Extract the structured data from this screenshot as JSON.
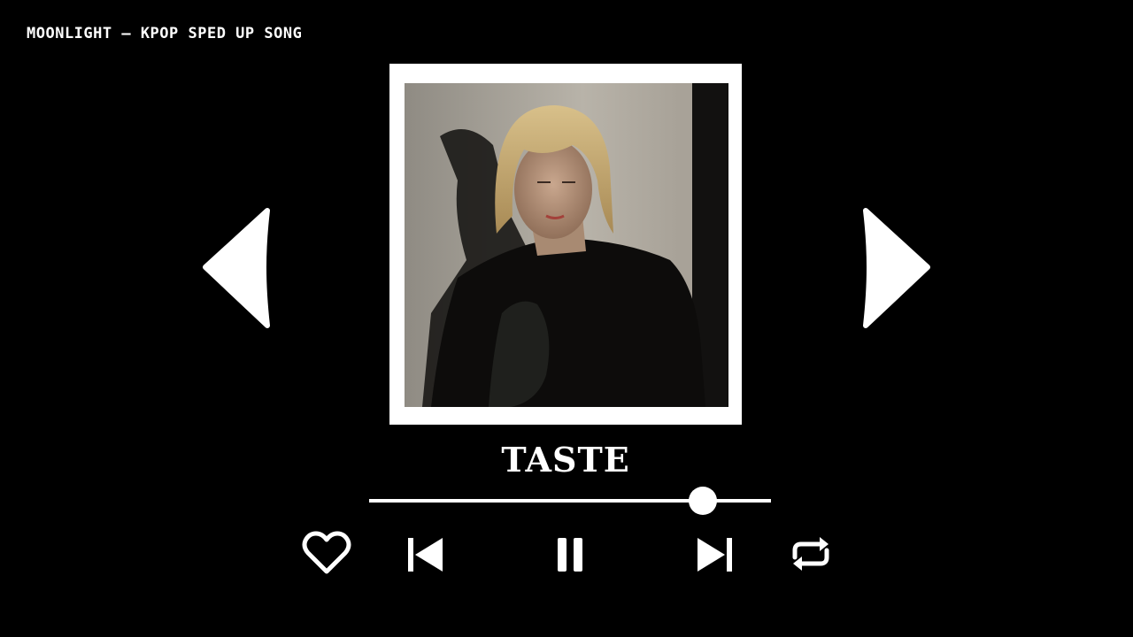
{
  "channel": {
    "title": "MOONLIGHT – KPOP SPED UP SONG"
  },
  "song": {
    "title": "TASTE"
  },
  "player": {
    "progress": 0.83,
    "state": "playing"
  },
  "icons": {
    "nav_left": "triangle-left-icon",
    "nav_right": "triangle-right-icon",
    "like": "heart-icon",
    "previous": "skip-previous-icon",
    "pause": "pause-icon",
    "next": "skip-next-icon",
    "repeat": "repeat-icon"
  },
  "colors": {
    "background": "#000000",
    "foreground": "#ffffff"
  }
}
